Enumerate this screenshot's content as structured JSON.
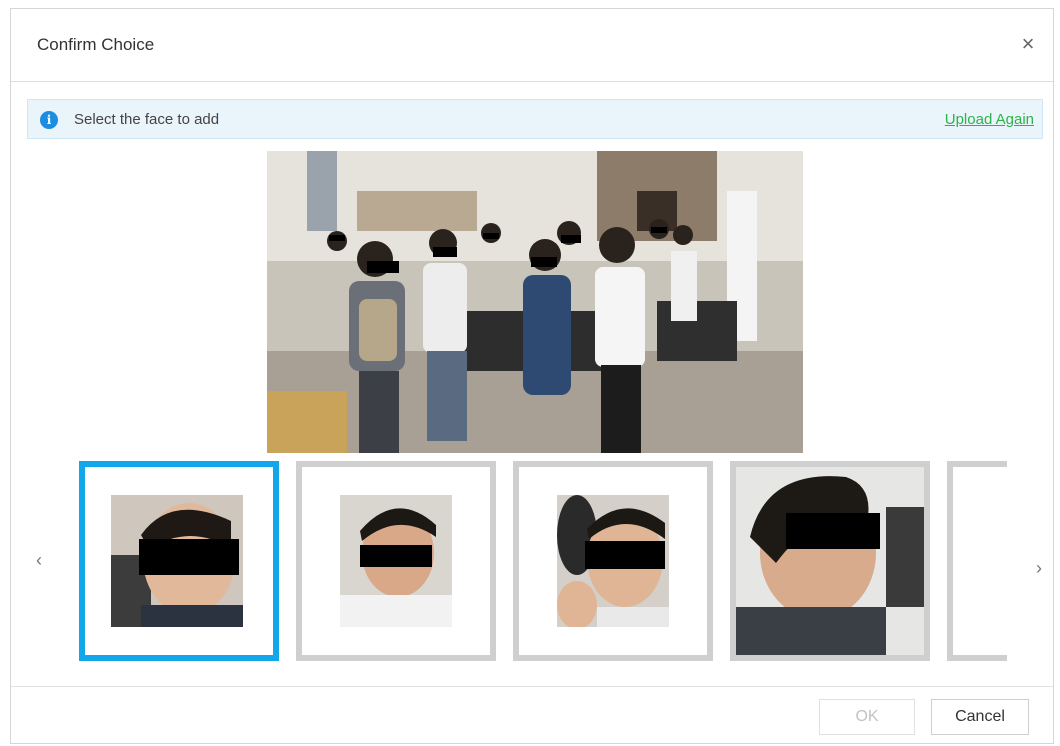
{
  "dialog": {
    "title": "Confirm Choice",
    "close_icon": "close-icon"
  },
  "info": {
    "icon": "info-icon",
    "icon_glyph": "i",
    "message": "Select the face to add",
    "upload_again": "Upload Again"
  },
  "thumbnails": {
    "items": [
      {
        "label": "face-1",
        "selected": true
      },
      {
        "label": "face-2",
        "selected": false
      },
      {
        "label": "face-3",
        "selected": false
      },
      {
        "label": "face-4",
        "selected": false
      },
      {
        "label": "face-5",
        "selected": false
      }
    ],
    "prev_icon": "chevron-left-icon",
    "next_icon": "chevron-right-icon",
    "prev_glyph": "‹",
    "next_glyph": "›"
  },
  "buttons": {
    "ok": "OK",
    "cancel": "Cancel"
  },
  "colors": {
    "selected_border": "#12a6ea",
    "link": "#2db34a",
    "info_icon": "#1c8de0"
  }
}
